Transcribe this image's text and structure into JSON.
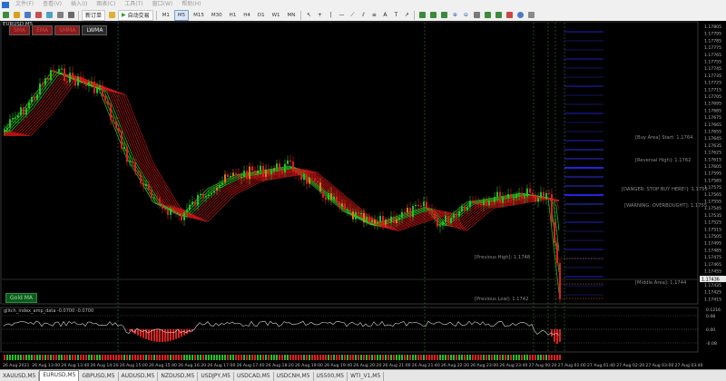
{
  "menubar": {
    "items": [
      "文件(F)",
      "查看(V)",
      "插入(I)",
      "图表(C)",
      "工具(T)",
      "窗口(W)",
      "帮助(H)"
    ]
  },
  "toolbar": {
    "new_order_label": "新订单",
    "autotrade_label": "自动交易",
    "timeframes": [
      "M1",
      "M5",
      "M15",
      "M30",
      "H1",
      "H4",
      "D1",
      "W1",
      "MN"
    ],
    "active_timeframe": "M5"
  },
  "chart": {
    "symbol_label": "EURUSD,M5",
    "mode_buttons": [
      {
        "label": "SMA",
        "active": false
      },
      {
        "label": "EMA",
        "active": false
      },
      {
        "label": "SMMA",
        "active": false
      },
      {
        "label": "LWMA",
        "active": true
      }
    ],
    "gold_button_label": "Gold MA",
    "price_scale": [
      "1.17805",
      "1.17795",
      "1.17785",
      "1.17775",
      "1.17765",
      "1.17755",
      "1.17745",
      "1.17735",
      "1.17725",
      "1.17715",
      "1.17705",
      "1.17695",
      "1.17685",
      "1.17675",
      "1.17665",
      "1.17655",
      "1.17645",
      "1.17635",
      "1.17625",
      "1.17615",
      "1.17605",
      "1.17595",
      "1.17585",
      "1.17575",
      "1.17565",
      "1.17555",
      "1.17545",
      "1.17535",
      "1.17525",
      "1.17515",
      "1.17505",
      "1.17495",
      "1.17485",
      "1.17475",
      "1.17465",
      "1.17455",
      "1.17445",
      "1.17435",
      "1.17425",
      "1.17415"
    ],
    "current_price": "1.17436",
    "levels": [
      {
        "label": "[Buy Area] Start: 1.1764"
      },
      {
        "label": "[Reversal High]: 1.1762"
      },
      {
        "label": "[DANGER: STOP BUY HERE!]: 1.1755"
      },
      {
        "label": "[WARNING: OVERBOUGHT]: 1.1755"
      },
      {
        "label": "[Previous High]: 1.1748"
      },
      {
        "label": "[Middle Area]: 1.1744"
      },
      {
        "label": "[Previous Low]: 1.1742"
      }
    ],
    "indicator_label": "glitch_index_amp_data -0.0700 -0.0700",
    "indicator_scale": [
      "0.1216",
      "0.08",
      "0.00",
      "-0.08"
    ],
    "time_labels": [
      "26 Aug 2021",
      "26 Aug 13:00",
      "26 Aug 13:40",
      "26 Aug 14:20",
      "26 Aug 15:00",
      "26 Aug 15:40",
      "26 Aug 16:20",
      "26 Aug 17:00",
      "26 Aug 17:40",
      "26 Aug 18:20",
      "26 Aug 19:00",
      "26 Aug 19:40",
      "26 Aug 20:20",
      "26 Aug 21:00",
      "26 Aug 21:40",
      "26 Aug 22:20",
      "26 Aug 23:00",
      "26 Aug 23:40",
      "27 Aug 00:20",
      "27 Aug 01:00",
      "27 Aug 01:40",
      "27 Aug 02:20",
      "27 Aug 03:00",
      "27 Aug 03:40"
    ],
    "colors": {
      "bull": "#22c21e",
      "bear": "#e01e1e",
      "orange": "#e0781e",
      "ribbon_bull": "#2ee82a",
      "ribbon_bear": "#d81818",
      "level": "#2a2aff"
    }
  },
  "tabs": {
    "items": [
      "XAUUSD,M5",
      "EURUSD,M5",
      "GBPUSD,M5",
      "AUDUSD,M5",
      "NZDUSD,M5",
      "USDJPY,M5",
      "USDCAD,M5",
      "USDCNH,M5",
      "US500,M5",
      "WTI_V1,M5"
    ],
    "active_index": 1
  }
}
